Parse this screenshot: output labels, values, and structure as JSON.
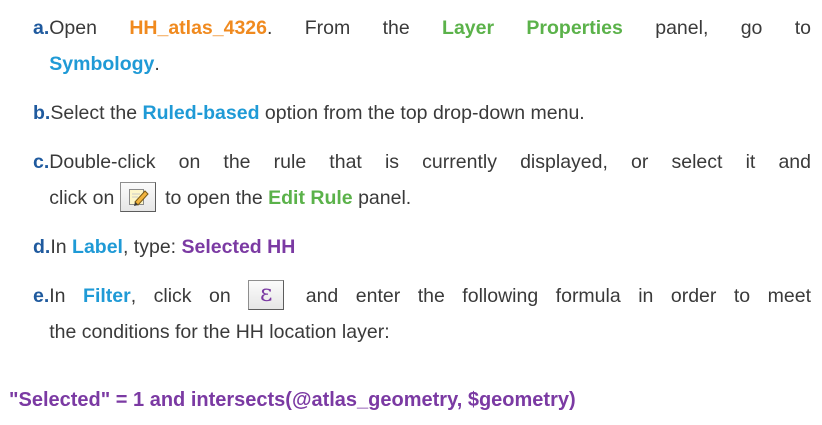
{
  "steps": [
    {
      "marker": "a.",
      "p1": "Open ",
      "atlas": "HH_atlas_4326",
      "p2": ". From the ",
      "panel": "Layer Properties",
      "p3": " panel, go to",
      "tab": "Symbology",
      "p4": "."
    },
    {
      "marker": "b.",
      "p1": "Select the ",
      "option": "Ruled-based",
      "p2": " option from the top drop-down menu."
    },
    {
      "marker": "c.",
      "line1": "Double-click on the rule that is currently displayed, or select it and",
      "p1": "click on ",
      "edit_icon": "edit-pencil-icon",
      "p2": " to open the ",
      "panel": "Edit Rule",
      "p3": " panel."
    },
    {
      "marker": "d.",
      "p1": "In ",
      "field": "Label",
      "p2": ", type: ",
      "value": "Selected HH"
    },
    {
      "marker": "e.",
      "p1": "In ",
      "field": "Filter",
      "p2": ", click on ",
      "expr_icon": "expression-epsilon-icon",
      "expr_glyph": "ε",
      "p3": " and enter the following formula in order to meet",
      "line2": "the conditions for the HH location layer:"
    }
  ],
  "formula": "\"Selected\" = 1 and intersects(@atlas_geometry, $geometry)",
  "colors": {
    "marker": "#1f5a9e",
    "orange": "#f08a1f",
    "green": "#5bb24a",
    "blue": "#1f9ad6",
    "purple": "#7b3aa3",
    "body_text": "#3a3a3a"
  }
}
